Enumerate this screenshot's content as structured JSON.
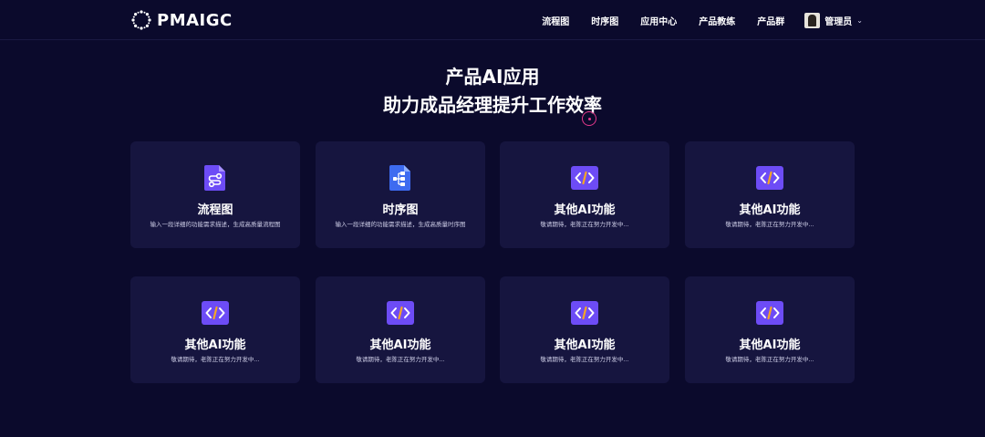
{
  "brand": {
    "name": "PMAIGC"
  },
  "nav": {
    "items": [
      "流程图",
      "时序图",
      "应用中心",
      "产品教练",
      "产品群"
    ],
    "user": "管理员"
  },
  "hero": {
    "line1": "产品AI应用",
    "line2": "助力成品经理提升工作效率"
  },
  "cards": [
    {
      "title": "流程图",
      "desc": "输入一段详细的功能需求描述，生成高质量流程图",
      "icon": "flowchart-icon"
    },
    {
      "title": "时序图",
      "desc": "输入一段详细的功能需求描述，生成高质量时序图",
      "icon": "sequence-diagram-icon"
    },
    {
      "title": "其他AI功能",
      "desc": "敬请期待，老陈正在努力开发中...",
      "icon": "code-icon"
    },
    {
      "title": "其他AI功能",
      "desc": "敬请期待，老陈正在努力开发中...",
      "icon": "code-icon"
    },
    {
      "title": "其他AI功能",
      "desc": "敬请期待，老陈正在努力开发中...",
      "icon": "code-icon"
    },
    {
      "title": "其他AI功能",
      "desc": "敬请期待，老陈正在努力开发中...",
      "icon": "code-icon"
    },
    {
      "title": "其他AI功能",
      "desc": "敬请期待，老陈正在努力开发中...",
      "icon": "code-icon"
    },
    {
      "title": "其他AI功能",
      "desc": "敬请期待，老陈正在努力开发中...",
      "icon": "code-icon"
    }
  ],
  "colors": {
    "background": "#0b0a2c",
    "card": "#16153f",
    "accent_purple": "#6d4cf6",
    "accent_blue": "#3d6bf0",
    "accent_orange": "#f5a524"
  }
}
